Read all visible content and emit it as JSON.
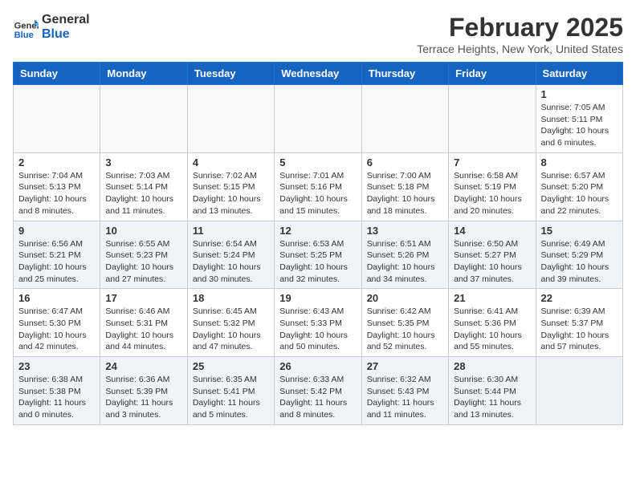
{
  "header": {
    "logo_line1": "General",
    "logo_line2": "Blue",
    "month_year": "February 2025",
    "location": "Terrace Heights, New York, United States"
  },
  "weekdays": [
    "Sunday",
    "Monday",
    "Tuesday",
    "Wednesday",
    "Thursday",
    "Friday",
    "Saturday"
  ],
  "weeks": [
    [
      {
        "day": "",
        "info": ""
      },
      {
        "day": "",
        "info": ""
      },
      {
        "day": "",
        "info": ""
      },
      {
        "day": "",
        "info": ""
      },
      {
        "day": "",
        "info": ""
      },
      {
        "day": "",
        "info": ""
      },
      {
        "day": "1",
        "info": "Sunrise: 7:05 AM\nSunset: 5:11 PM\nDaylight: 10 hours\nand 6 minutes."
      }
    ],
    [
      {
        "day": "2",
        "info": "Sunrise: 7:04 AM\nSunset: 5:13 PM\nDaylight: 10 hours\nand 8 minutes."
      },
      {
        "day": "3",
        "info": "Sunrise: 7:03 AM\nSunset: 5:14 PM\nDaylight: 10 hours\nand 11 minutes."
      },
      {
        "day": "4",
        "info": "Sunrise: 7:02 AM\nSunset: 5:15 PM\nDaylight: 10 hours\nand 13 minutes."
      },
      {
        "day": "5",
        "info": "Sunrise: 7:01 AM\nSunset: 5:16 PM\nDaylight: 10 hours\nand 15 minutes."
      },
      {
        "day": "6",
        "info": "Sunrise: 7:00 AM\nSunset: 5:18 PM\nDaylight: 10 hours\nand 18 minutes."
      },
      {
        "day": "7",
        "info": "Sunrise: 6:58 AM\nSunset: 5:19 PM\nDaylight: 10 hours\nand 20 minutes."
      },
      {
        "day": "8",
        "info": "Sunrise: 6:57 AM\nSunset: 5:20 PM\nDaylight: 10 hours\nand 22 minutes."
      }
    ],
    [
      {
        "day": "9",
        "info": "Sunrise: 6:56 AM\nSunset: 5:21 PM\nDaylight: 10 hours\nand 25 minutes."
      },
      {
        "day": "10",
        "info": "Sunrise: 6:55 AM\nSunset: 5:23 PM\nDaylight: 10 hours\nand 27 minutes."
      },
      {
        "day": "11",
        "info": "Sunrise: 6:54 AM\nSunset: 5:24 PM\nDaylight: 10 hours\nand 30 minutes."
      },
      {
        "day": "12",
        "info": "Sunrise: 6:53 AM\nSunset: 5:25 PM\nDaylight: 10 hours\nand 32 minutes."
      },
      {
        "day": "13",
        "info": "Sunrise: 6:51 AM\nSunset: 5:26 PM\nDaylight: 10 hours\nand 34 minutes."
      },
      {
        "day": "14",
        "info": "Sunrise: 6:50 AM\nSunset: 5:27 PM\nDaylight: 10 hours\nand 37 minutes."
      },
      {
        "day": "15",
        "info": "Sunrise: 6:49 AM\nSunset: 5:29 PM\nDaylight: 10 hours\nand 39 minutes."
      }
    ],
    [
      {
        "day": "16",
        "info": "Sunrise: 6:47 AM\nSunset: 5:30 PM\nDaylight: 10 hours\nand 42 minutes."
      },
      {
        "day": "17",
        "info": "Sunrise: 6:46 AM\nSunset: 5:31 PM\nDaylight: 10 hours\nand 44 minutes."
      },
      {
        "day": "18",
        "info": "Sunrise: 6:45 AM\nSunset: 5:32 PM\nDaylight: 10 hours\nand 47 minutes."
      },
      {
        "day": "19",
        "info": "Sunrise: 6:43 AM\nSunset: 5:33 PM\nDaylight: 10 hours\nand 50 minutes."
      },
      {
        "day": "20",
        "info": "Sunrise: 6:42 AM\nSunset: 5:35 PM\nDaylight: 10 hours\nand 52 minutes."
      },
      {
        "day": "21",
        "info": "Sunrise: 6:41 AM\nSunset: 5:36 PM\nDaylight: 10 hours\nand 55 minutes."
      },
      {
        "day": "22",
        "info": "Sunrise: 6:39 AM\nSunset: 5:37 PM\nDaylight: 10 hours\nand 57 minutes."
      }
    ],
    [
      {
        "day": "23",
        "info": "Sunrise: 6:38 AM\nSunset: 5:38 PM\nDaylight: 11 hours\nand 0 minutes."
      },
      {
        "day": "24",
        "info": "Sunrise: 6:36 AM\nSunset: 5:39 PM\nDaylight: 11 hours\nand 3 minutes."
      },
      {
        "day": "25",
        "info": "Sunrise: 6:35 AM\nSunset: 5:41 PM\nDaylight: 11 hours\nand 5 minutes."
      },
      {
        "day": "26",
        "info": "Sunrise: 6:33 AM\nSunset: 5:42 PM\nDaylight: 11 hours\nand 8 minutes."
      },
      {
        "day": "27",
        "info": "Sunrise: 6:32 AM\nSunset: 5:43 PM\nDaylight: 11 hours\nand 11 minutes."
      },
      {
        "day": "28",
        "info": "Sunrise: 6:30 AM\nSunset: 5:44 PM\nDaylight: 11 hours\nand 13 minutes."
      },
      {
        "day": "",
        "info": ""
      }
    ]
  ]
}
